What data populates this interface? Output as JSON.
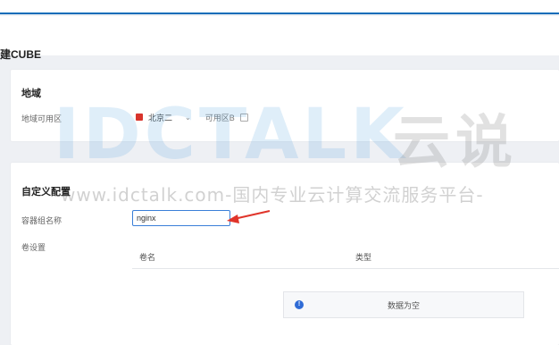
{
  "page": {
    "title": "建CUBE"
  },
  "region_section": {
    "title": "地域",
    "zone_label": "地域可用区",
    "zone_value": "北京二",
    "az_label": "可用区B"
  },
  "custom_section": {
    "title": "自定义配置",
    "container_group_label": "容器组名称",
    "container_group_value": "nginx",
    "volume_label": "卷设置",
    "volume_table": {
      "columns": [
        "卷名",
        "类型"
      ],
      "empty_text": "数据为空"
    }
  },
  "watermark": {
    "logo": "IDCTALK",
    "brand_cn": "云说",
    "url_text": "www.idctalk.com-国内专业云计算交流服务平台-"
  },
  "colors": {
    "accent": "#3a7fd8",
    "topbar_accent": "#0a6cb8",
    "flag": "#d8342c",
    "arrow": "#e0342a"
  }
}
